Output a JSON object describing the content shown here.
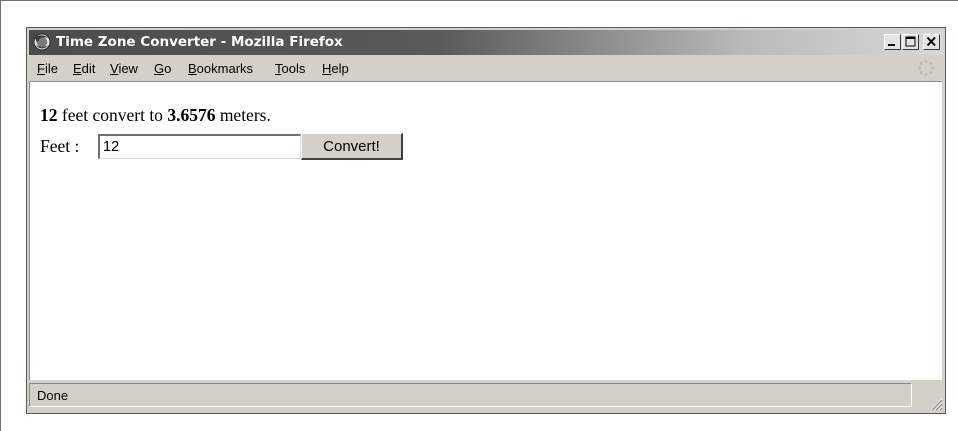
{
  "window": {
    "title": "Time Zone Converter - Mozilla Firefox"
  },
  "menubar": {
    "items": [
      {
        "label": "File"
      },
      {
        "label": "Edit"
      },
      {
        "label": "View"
      },
      {
        "label": "Go"
      },
      {
        "label": "Bookmarks"
      },
      {
        "label": "Tools"
      },
      {
        "label": "Help"
      }
    ]
  },
  "content": {
    "result": {
      "input_value": "12",
      "middle_text": " feet convert to ",
      "output_value": "3.6576",
      "tail_text": " meters."
    },
    "form": {
      "label": "Feet : ",
      "input_value": "12",
      "button_label": "Convert!"
    }
  },
  "statusbar": {
    "text": "Done"
  },
  "icons": {
    "app": "firefox-icon",
    "minimize": "minimize-icon",
    "maximize": "maximize-icon",
    "close": "close-icon",
    "throbber": "throbber-icon",
    "resize": "resize-grip-icon"
  }
}
